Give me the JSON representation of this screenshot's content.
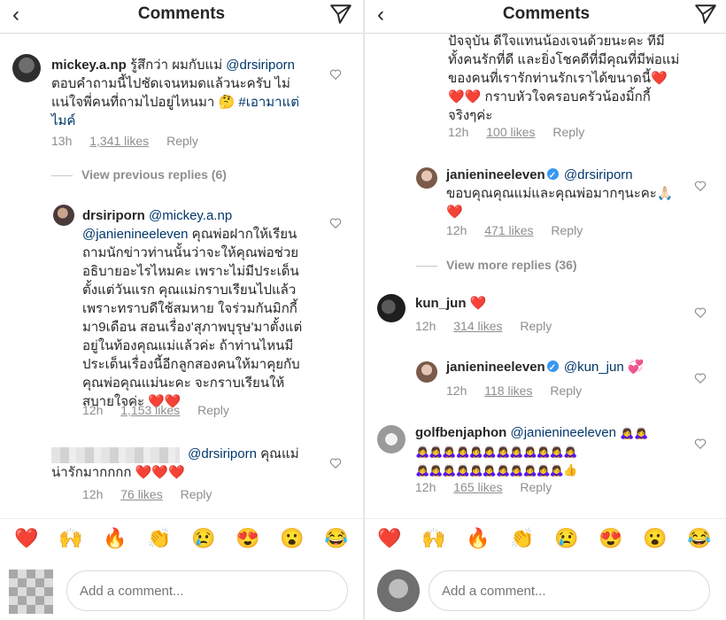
{
  "left": {
    "header": {
      "title": "Comments"
    },
    "comments": [
      {
        "username": "mickey.a.np",
        "text_line1": "รู้สึกว่า ผมกับแม่",
        "mention": "@drsiriporn",
        "text_line2": "ตอบคำถามนี้ไปชัดเจนหมดแล้วนะครับ ไม่",
        "text_line3": "แน่ใจพี่คนที่ถามไปอยู่ไหนมา 🤔",
        "hashtag": "#เอามาแต่",
        "hashtag_line2": "ไมค์",
        "time": "13h",
        "likes": "1,341 likes",
        "reply": "Reply"
      }
    ],
    "view_previous": "View previous replies (6)",
    "reply1": {
      "username": "drsiriporn",
      "mention1": "@mickey.a.np",
      "mention2": "@janienineeleven",
      "line1": "คุณพ่อฝากให้เรียน",
      "line2": "ถามนักข่าวท่านนั้นว่าจะให้คุณพ่อช่วย",
      "line3": "อธิบายอะไรไหมคะ เพราะไม่มีประเด็น",
      "line4": "ตั้งแต่วันแรก คุณแม่กราบเรียนไปแล้ว",
      "line5": "เพราะทราบดีใช้สมหาย ใจร่วมกันมิกกี้",
      "line6": "มา9เดือน สอนเรื่อง'สุภาพบุรุษ'มาตั้งแต่",
      "line7": "อยู่ในท้องคุณแม่แล้วค่ะ ถ้าท่านไหนมี",
      "line8": "ประเด็นเรื่องนี้อีกลูกสองคนให้มาคุยกับ",
      "line9": "คุณพ่อคุณแม่นะคะ จะกราบเรียนให้",
      "line10": "สบายใจค่ะ ❤️❤️",
      "time": "12h",
      "likes": "1,153 likes",
      "reply": "Reply"
    },
    "reply2": {
      "mention": "@drsiriporn",
      "line1": "คุณแม่",
      "line2": "น่ารักมากกกก ❤️❤️❤️",
      "time": "12h",
      "likes": "76 likes",
      "reply": "Reply"
    },
    "reactions": [
      "❤️",
      "🙌",
      "🔥",
      "👏",
      "😢",
      "😍",
      "😮",
      "😂"
    ],
    "composer": {
      "placeholder": "Add a comment..."
    }
  },
  "right": {
    "header": {
      "title": "Comments"
    },
    "top_comment": {
      "line1": "ปัจจุบัน ดีใจแทนน้องเจนด้วยนะคะ ที่มี",
      "line2": "ทั้งคนรักที่ดี และยิ่งโชคดีที่มีคุณที่มีพ่อแม่",
      "line3": "ของคนที่เรารักท่านรักเราได้ขนาดนี้❤️",
      "line4": "❤️❤️ กราบหัวใจครอบครัวน้องมิ้กกี้",
      "line5": "จริงๆค่ะ",
      "time": "12h",
      "likes": "100 likes",
      "reply": "Reply"
    },
    "reply_jane1": {
      "username": "janienineeleven",
      "mention": "@drsiriporn",
      "line1": "ขอบคุณคุณแม่และคุณพ่อมากๆนะคะ🙏🏻",
      "line2": "❤️",
      "time": "12h",
      "likes": "471 likes",
      "reply": "Reply"
    },
    "view_more": "View more replies (36)",
    "comment_kun": {
      "username": "kun_jun",
      "text": "❤️",
      "time": "12h",
      "likes": "314 likes",
      "reply": "Reply"
    },
    "reply_jane2": {
      "username": "janienineeleven",
      "mention": "@kun_jun",
      "emoji": "💞",
      "time": "12h",
      "likes": "118 likes",
      "reply": "Reply"
    },
    "comment_golf": {
      "username": "golfbenjaphon",
      "mention": "@janienineeleven",
      "line1_emoji": "🙇‍♀️🙇‍♀️",
      "line2_emoji": "🙇‍♀️🙇‍♀️🙇‍♀️🙇‍♀️🙇‍♀️🙇‍♀️🙇‍♀️🙇‍♀️🙇‍♀️🙇‍♀️🙇‍♀️🙇‍♀️",
      "line3_emoji": "🙇‍♀️🙇‍♀️🙇‍♀️🙇‍♀️🙇‍♀️🙇‍♀️🙇‍♀️🙇‍♀️🙇‍♀️🙇‍♀️🙇‍♀️👍",
      "time": "12h",
      "likes": "165 likes",
      "reply": "Reply"
    },
    "reactions": [
      "❤️",
      "🙌",
      "🔥",
      "👏",
      "😢",
      "😍",
      "😮",
      "😂"
    ],
    "composer": {
      "placeholder": "Add a comment..."
    }
  },
  "colors": {
    "link": "#00376b",
    "meta": "#8e8e8e",
    "verified": "#3897f0",
    "border": "#dbdbdb"
  }
}
